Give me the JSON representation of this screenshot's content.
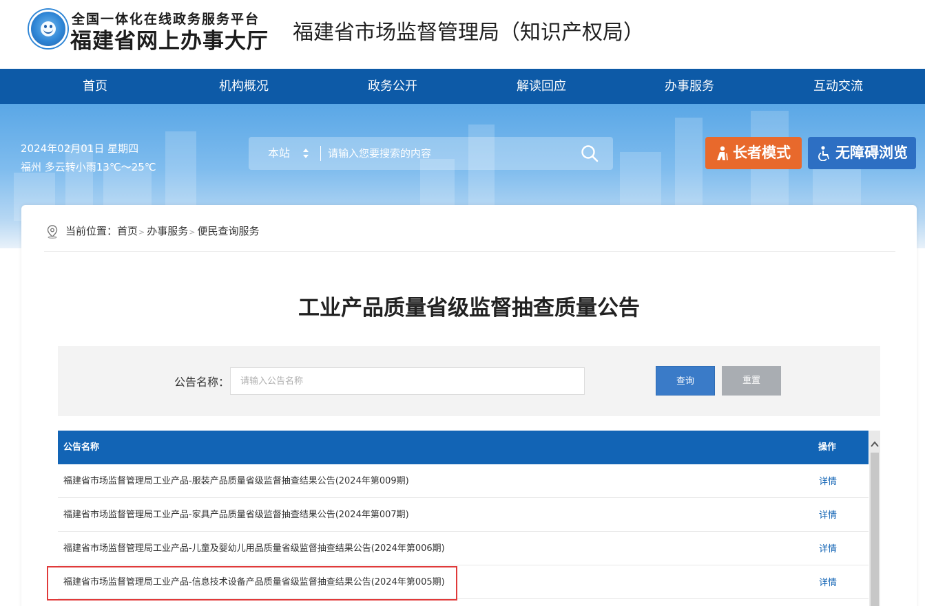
{
  "header": {
    "logo_line1": "全国一体化在线政务服务平台",
    "logo_line2": "福建省网上办事大厅",
    "dept_title": "福建省市场监督管理局（知识产权局）"
  },
  "nav": {
    "items": [
      {
        "label": "首页"
      },
      {
        "label": "机构概况"
      },
      {
        "label": "政务公开"
      },
      {
        "label": "解读回应"
      },
      {
        "label": "办事服务"
      },
      {
        "label": "互动交流"
      }
    ]
  },
  "banner": {
    "date": "2024年02月01日 星期四",
    "weather": "福州 多云转小雨13℃～25℃",
    "search_scope": "本站",
    "search_placeholder": "请输入您要搜索的内容",
    "elder_mode": "长者模式",
    "accessible": "无障碍浏览"
  },
  "breadcrumb": {
    "prefix": "当前位置：",
    "items": [
      "首页",
      "办事服务",
      "便民查询服务"
    ],
    "separator": ">"
  },
  "page_title": "工业产品质量省级监督抽查质量公告",
  "filter": {
    "label": "公告名称：",
    "placeholder": "请输入公告名称",
    "query": "查询",
    "reset": "重置"
  },
  "table": {
    "col_name": "公告名称",
    "col_op": "操作",
    "rows": [
      {
        "name": "福建省市场监督管理局工业产品-服装产品质量省级监督抽查结果公告(2024年第009期)",
        "op": "详情"
      },
      {
        "name": "福建省市场监督管理局工业产品-家具产品质量省级监督抽查结果公告(2024年第007期)",
        "op": "详情"
      },
      {
        "name": "福建省市场监督管理局工业产品-儿童及婴幼儿用品质量省级监督抽查结果公告(2024年第006期)",
        "op": "详情"
      },
      {
        "name": "福建省市场监督管理局工业产品-信息技术设备产品质量省级监督抽查结果公告(2024年第005期)",
        "op": "详情"
      }
    ]
  },
  "colors": {
    "nav_bg": "#0d5aa7",
    "accent_blue": "#1264b5",
    "elder_orange": "#e8692c",
    "highlight_red": "#e03a3a"
  },
  "icons": [
    "logo-emblem",
    "updown-arrows-icon",
    "search-icon",
    "elder-icon",
    "wheelchair-icon",
    "location-pin-icon",
    "chevron-up-icon"
  ]
}
